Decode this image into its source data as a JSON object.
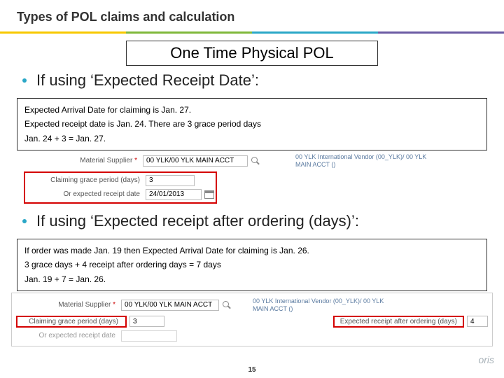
{
  "title": "Types of POL claims and calculation",
  "section_header": "One Time Physical POL",
  "bullet1": "If using ‘Expected Receipt Date’:",
  "box1": {
    "l1": "Expected Arrival Date for claiming is Jan. 27.",
    "l2": "Expected receipt date is Jan. 24. There are 3 grace period days",
    "l3": "Jan. 24 + 3 = Jan. 27."
  },
  "form1": {
    "material_supplier_label": "Material Supplier",
    "material_supplier_value": "00 YLK/00 YLK MAIN ACCT",
    "account_text": "00 YLK International Vendor (00_YLK)/ 00 YLK MAIN ACCT ()",
    "grace_label": "Claiming grace period (days)",
    "grace_value": "3",
    "or_label": "Or expected receipt date",
    "or_value": "24/01/2013"
  },
  "bullet2": "If using ‘Expected receipt after ordering (days)’:",
  "box2": {
    "l1": "If order was made Jan. 19 then Expected Arrival Date for claiming is Jan. 26.",
    "l2": "3 grace days + 4 receipt after ordering days = 7 days",
    "l3": "Jan. 19 + 7 = Jan. 26."
  },
  "form2": {
    "material_supplier_label": "Material Supplier",
    "material_supplier_value": "00 YLK/00 YLK MAIN ACCT",
    "account_text": "00 YLK International Vendor (00_YLK)/ 00 YLK MAIN ACCT ()",
    "grace_label": "Claiming grace period (days)",
    "grace_value": "3",
    "expected_after_label": "Expected receipt after ordering (days)",
    "expected_after_value": "4",
    "or_label": "Or expected receipt date"
  },
  "page_number": "15",
  "logo_text": "oris"
}
